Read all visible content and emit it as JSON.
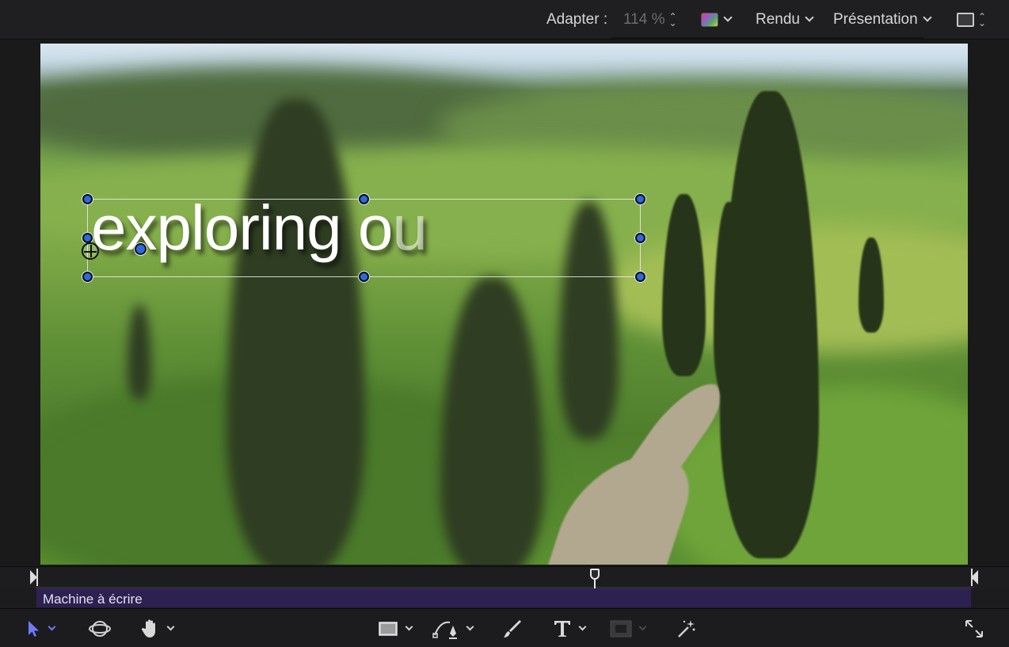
{
  "topbar": {
    "fit_label": "Adapter :",
    "fit_value": "114 %",
    "color_icon": "color-channels-icon",
    "render_label": "Rendu",
    "view_label": "Présentation",
    "layout_icon": "layout-icon"
  },
  "canvas": {
    "title_text_main": "exploring o",
    "title_text_fade": "u"
  },
  "timeline": {
    "clip_label": "Machine à écrire"
  },
  "toolbar": {
    "tools": [
      "select-tool-icon",
      "3d-transform-icon",
      "pan-hand-icon",
      "rectangle-shape-icon",
      "bezier-pen-icon",
      "paint-brush-icon",
      "text-tool-icon",
      "mask-icon",
      "magic-wand-icon",
      "fullscreen-icon"
    ]
  },
  "colors": {
    "accent_blue": "#2a6bdc",
    "select_tool": "#6e7bff",
    "clip_purple": "#2c2150"
  }
}
